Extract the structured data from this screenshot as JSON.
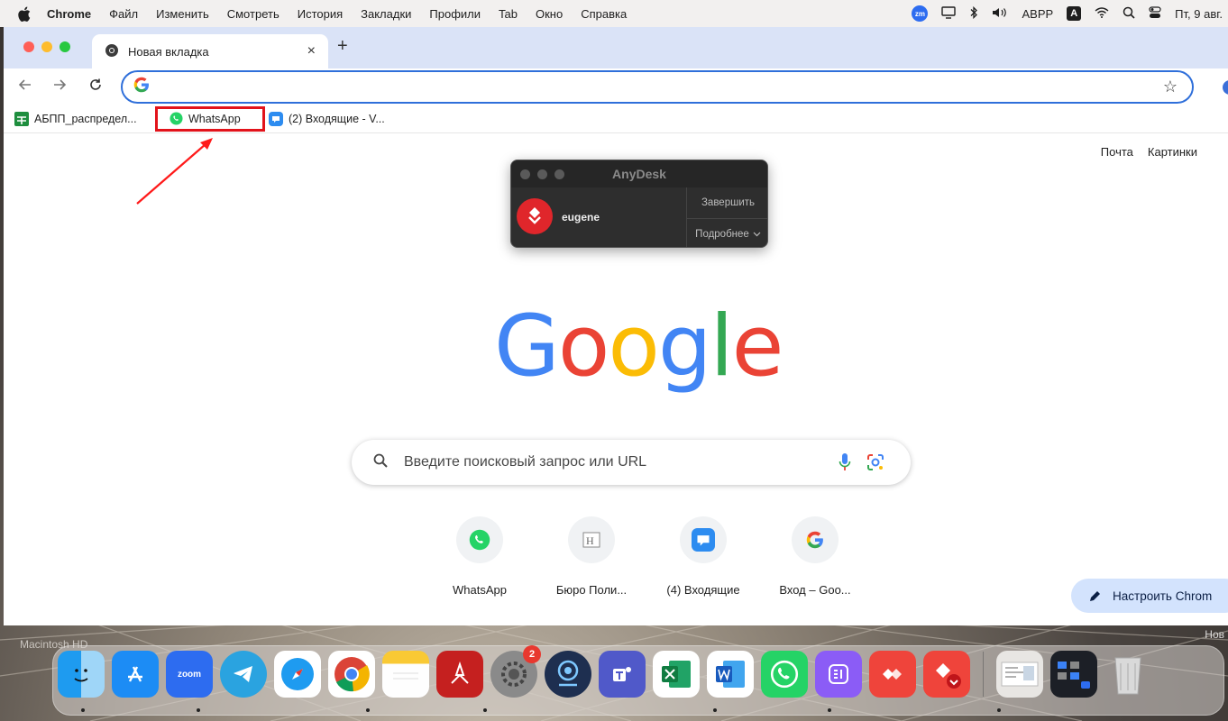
{
  "menubar": {
    "items": [
      "Chrome",
      "Файл",
      "Изменить",
      "Смотреть",
      "История",
      "Закладки",
      "Профили",
      "Tab",
      "Окно",
      "Справка"
    ],
    "status": {
      "zoom": "zm",
      "keyboard": "ABPP",
      "input_source": "A",
      "datetime": "Пт, 9 авг."
    }
  },
  "browser": {
    "tab_title": "Новая вкладка",
    "new_tab": "+",
    "close_tab": "×",
    "omnibox_value": "",
    "bookmarks": [
      {
        "label": "АБПП_распредел..."
      },
      {
        "label": "WhatsApp"
      },
      {
        "label": "(2) Входящие - V..."
      }
    ]
  },
  "anydesk": {
    "title": "AnyDesk",
    "user": "eugene",
    "end_button": "Завершить",
    "more_button": "Подробнее"
  },
  "page": {
    "links": [
      "Почта",
      "Картинки"
    ],
    "logo": {
      "letters": [
        "G",
        "o",
        "o",
        "g",
        "l",
        "e"
      ],
      "colors": [
        "#4285F4",
        "#EA4335",
        "#FBBC05",
        "#4285F4",
        "#34A853",
        "#EA4335"
      ]
    },
    "search_placeholder": "Введите поисковый запрос или URL",
    "shortcuts": [
      {
        "label": "WhatsApp",
        "icon": "whatsapp-icon"
      },
      {
        "label": "Бюро Поли...",
        "icon": "buro-icon"
      },
      {
        "label": "(4) Входящие",
        "icon": "mail-icon"
      },
      {
        "label": "Вход – Goo...",
        "icon": "google-icon"
      }
    ],
    "customize_label": "Настроить Chrom"
  },
  "desktop": {
    "disk_label": "Macintosh HD",
    "corner_label": "Нов",
    "dock": {
      "zoom_label": "zoom",
      "settings_badge": "2"
    }
  }
}
